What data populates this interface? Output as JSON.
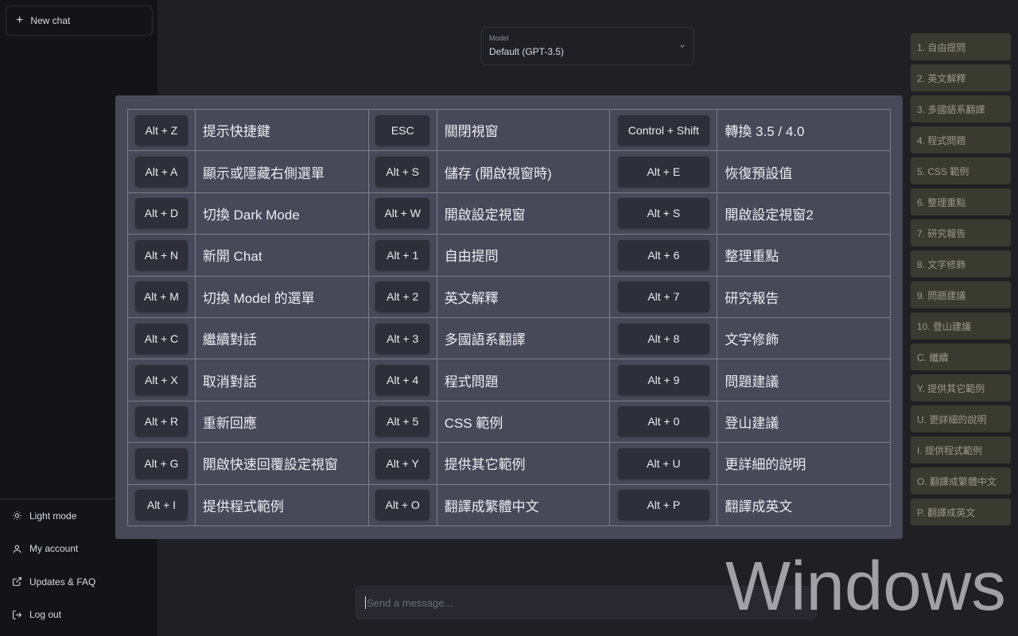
{
  "sidebar": {
    "new_chat": "New chat",
    "bottom": [
      {
        "label": "Light mode",
        "icon": "sun-icon"
      },
      {
        "label": "My account",
        "icon": "user-icon"
      },
      {
        "label": "Updates & FAQ",
        "icon": "external-link-icon"
      },
      {
        "label": "Log out",
        "icon": "logout-icon"
      }
    ]
  },
  "model": {
    "label": "Model",
    "value": "Default (GPT-3.5)"
  },
  "right_panel": [
    "1. 自由提問",
    "2. 英文解釋",
    "3. 多國語系翻譯",
    "4. 程式問題",
    "5. CSS 範例",
    "6. 整理重點",
    "7. 研究報告",
    "8. 文字修飾",
    "9. 問題建議",
    "10. 登山建議",
    "C. 繼續",
    "Y. 提供其它範例",
    "U. 更詳細的說明",
    "I. 提供程式範例",
    "O. 翻譯成繁體中文",
    "P. 翻譯成英文"
  ],
  "shortcuts": [
    [
      {
        "key": "Alt + Z",
        "label": "提示快捷鍵"
      },
      {
        "key": "ESC",
        "label": "關閉視窗"
      },
      {
        "key": "Control + Shift",
        "label": "轉換 3.5 / 4.0"
      }
    ],
    [
      {
        "key": "Alt + A",
        "label": "顯示或隱藏右側選單"
      },
      {
        "key": "Alt + S",
        "label": "儲存 (開啟視窗時)"
      },
      {
        "key": "Alt + E",
        "label": "恢復預設值"
      }
    ],
    [
      {
        "key": "Alt + D",
        "label": "切換 Dark Mode"
      },
      {
        "key": "Alt + W",
        "label": "開啟設定視窗"
      },
      {
        "key": "Alt + S",
        "label": "開啟設定視窗2"
      }
    ],
    [
      {
        "key": "Alt + N",
        "label": "新開 Chat"
      },
      {
        "key": "Alt + 1",
        "label": "自由提問"
      },
      {
        "key": "Alt + 6",
        "label": "整理重點"
      }
    ],
    [
      {
        "key": "Alt + M",
        "label": "切換 Model 的選單"
      },
      {
        "key": "Alt + 2",
        "label": "英文解釋"
      },
      {
        "key": "Alt + 7",
        "label": "研究報告"
      }
    ],
    [
      {
        "key": "Alt + C",
        "label": "繼續對話"
      },
      {
        "key": "Alt + 3",
        "label": "多國語系翻譯"
      },
      {
        "key": "Alt + 8",
        "label": "文字修飾"
      }
    ],
    [
      {
        "key": "Alt + X",
        "label": "取消對話"
      },
      {
        "key": "Alt + 4",
        "label": "程式問題"
      },
      {
        "key": "Alt + 9",
        "label": "問題建議"
      }
    ],
    [
      {
        "key": "Alt + R",
        "label": "重新回應"
      },
      {
        "key": "Alt + 5",
        "label": "CSS 範例"
      },
      {
        "key": "Alt + 0",
        "label": "登山建議"
      }
    ],
    [
      {
        "key": "Alt + G",
        "label": "開啟快速回覆設定視窗"
      },
      {
        "key": "Alt + Y",
        "label": "提供其它範例"
      },
      {
        "key": "Alt + U",
        "label": "更詳細的說明"
      }
    ],
    [
      {
        "key": "Alt + I",
        "label": "提供程式範例"
      },
      {
        "key": "Alt + O",
        "label": "翻譯成繁體中文"
      },
      {
        "key": "Alt + P",
        "label": "翻譯成英文"
      }
    ]
  ],
  "input": {
    "placeholder": "Send a message..."
  },
  "watermark": "Windows"
}
